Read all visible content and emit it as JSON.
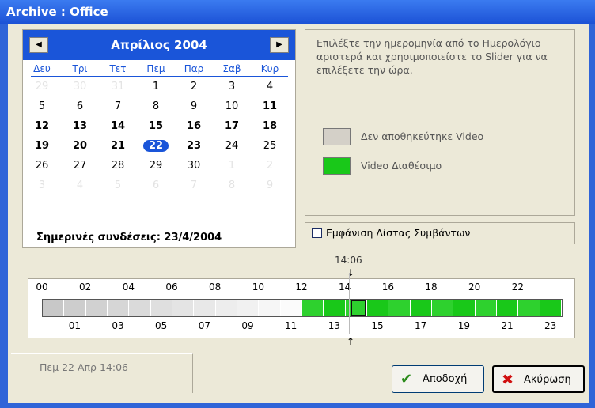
{
  "window": {
    "title": "Archive : Office"
  },
  "calendar": {
    "month_label": "Απρίλιος 2004",
    "weekdays": [
      "Δευ",
      "Τρι",
      "Τετ",
      "Πεμ",
      "Παρ",
      "Σαβ",
      "Κυρ"
    ],
    "rows": [
      [
        "29",
        "30",
        "31",
        "1",
        "2",
        "3",
        "4"
      ],
      [
        "5",
        "6",
        "7",
        "8",
        "9",
        "10",
        "11"
      ],
      [
        "12",
        "13",
        "14",
        "15",
        "16",
        "17",
        "18"
      ],
      [
        "19",
        "20",
        "21",
        "22",
        "23",
        "24",
        "25"
      ],
      [
        "26",
        "27",
        "28",
        "29",
        "30",
        "1",
        "2"
      ],
      [
        "3",
        "4",
        "5",
        "6",
        "7",
        "8",
        "9"
      ]
    ],
    "today_label": "Σημερινές συνδέσεις: 23/4/2004"
  },
  "info": {
    "instructions": "Επιλέξτε την ημερομηνία από το Ημερολόγιο αριστερά και χρησιμοποιείστε το Slider για να επιλέξετε την ώρα.",
    "legend_no_video": "Δεν αποθηκεύτηκε Video",
    "legend_video": "Video Διαθέσιμο",
    "color_no_video": "#d4d0c8",
    "color_video": "#19c819"
  },
  "events_checkbox_label": "Εμφάνιση Λίστας Συμβάντων",
  "timeline": {
    "current_time": "14:06",
    "top_labels": [
      "00",
      "02",
      "04",
      "06",
      "08",
      "10",
      "12",
      "14",
      "16",
      "18",
      "20",
      "22"
    ],
    "bottom_labels": [
      "01",
      "03",
      "05",
      "07",
      "09",
      "11",
      "13",
      "15",
      "17",
      "19",
      "21",
      "23"
    ]
  },
  "tab_label": "Πεμ 22 Απρ 14:06",
  "buttons": {
    "accept": "Αποδοχή",
    "cancel": "Ακύρωση"
  }
}
